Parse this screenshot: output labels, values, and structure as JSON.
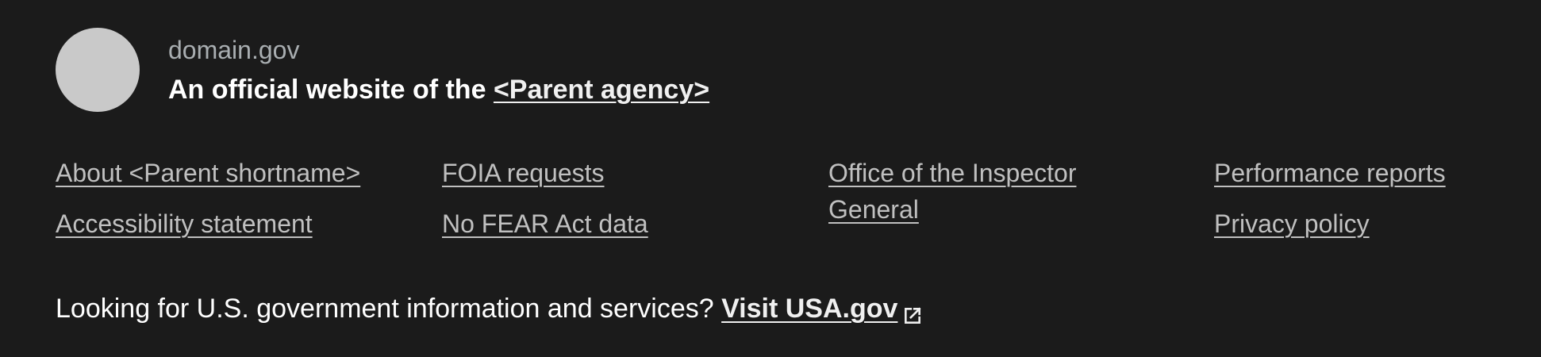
{
  "identifier": {
    "domain": "domain.gov",
    "disclaimer_prefix": "An official website of the ",
    "parent_agency_link": "<Parent agency>"
  },
  "links": {
    "columns": [
      [
        "About <Parent shortname>",
        "Accessibility statement"
      ],
      [
        "FOIA requests",
        "No FEAR Act data"
      ],
      [
        "Office of the Inspector General"
      ],
      [
        "Performance reports",
        "Privacy policy"
      ]
    ]
  },
  "usagov": {
    "prompt": "Looking for U.S. government information and services? ",
    "link": "Visit USA.gov",
    "icon": "external-link-icon"
  },
  "colors": {
    "background": "#1b1b1b",
    "logo": "#c9c9c9",
    "domain_text": "#a9aeb1",
    "link_text": "#c0c0c0"
  }
}
